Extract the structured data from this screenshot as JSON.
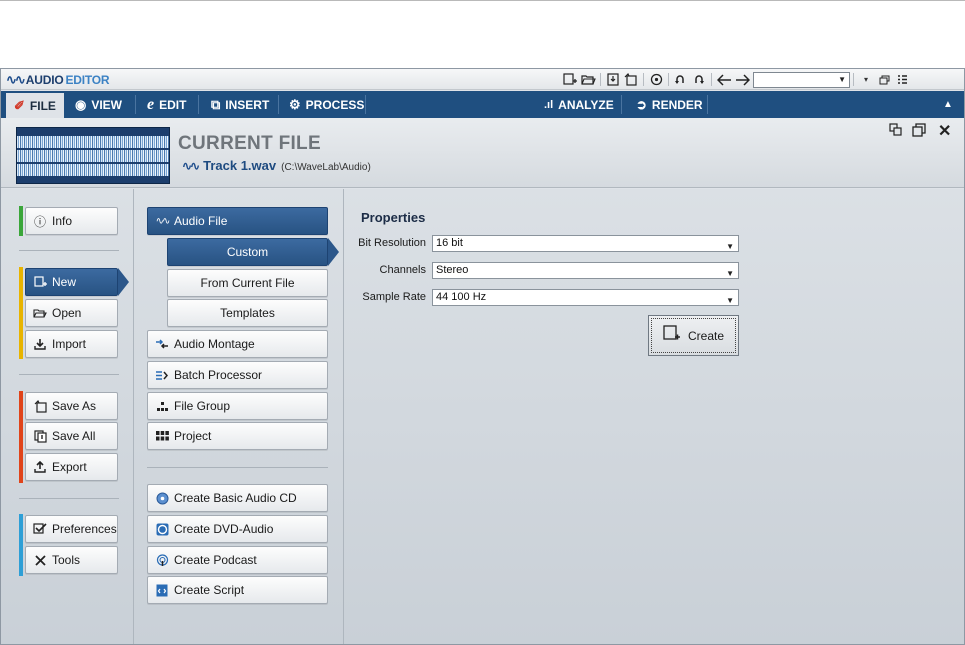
{
  "app": {
    "name_part1": "AUDIO",
    "name_part2": "EDITOR",
    "logo_glyph": "∿∿"
  },
  "tabs": [
    {
      "label": "FILE",
      "icon": "file-icon",
      "active": true
    },
    {
      "label": "VIEW",
      "icon": "eye-icon",
      "active": false
    },
    {
      "label": "EDIT",
      "icon": "edit-icon",
      "active": false
    },
    {
      "label": "INSERT",
      "icon": "insert-icon",
      "active": false
    },
    {
      "label": "PROCESS",
      "icon": "process-icon",
      "active": false
    },
    {
      "label": "ANALYZE",
      "icon": "analyze-icon",
      "active": false
    },
    {
      "label": "RENDER",
      "icon": "render-icon",
      "active": false
    }
  ],
  "header": {
    "title": "CURRENT FILE",
    "file_name": "Track 1.wav",
    "file_path": "(C:\\WaveLab\\Audio)"
  },
  "sidebar": {
    "groups": [
      {
        "color": "#3aa63a",
        "items": [
          {
            "label": "Info",
            "icon": "info-icon"
          }
        ]
      },
      {
        "color": "#e8b400",
        "items": [
          {
            "label": "New",
            "icon": "new-file-icon",
            "selected": true
          },
          {
            "label": "Open",
            "icon": "open-folder-icon"
          },
          {
            "label": "Import",
            "icon": "import-icon"
          }
        ]
      },
      {
        "color": "#e0441a",
        "items": [
          {
            "label": "Save As",
            "icon": "save-as-icon"
          },
          {
            "label": "Save All",
            "icon": "save-all-icon"
          },
          {
            "label": "Export",
            "icon": "export-icon"
          }
        ]
      },
      {
        "color": "#2e9fd6",
        "items": [
          {
            "label": "Preferences",
            "icon": "preferences-icon"
          },
          {
            "label": "Tools",
            "icon": "tools-icon"
          }
        ]
      }
    ]
  },
  "new_types": {
    "audio_file": "Audio File",
    "sub_items": [
      "Custom",
      "From Current File",
      "Templates"
    ],
    "others": [
      {
        "label": "Audio Montage",
        "icon": "audio-montage-icon"
      },
      {
        "label": "Batch Processor",
        "icon": "batch-processor-icon"
      },
      {
        "label": "File Group",
        "icon": "file-group-icon"
      },
      {
        "label": "Project",
        "icon": "project-icon"
      }
    ],
    "create_items": [
      {
        "label": "Create Basic Audio CD",
        "icon": "cd-icon"
      },
      {
        "label": "Create DVD-Audio",
        "icon": "dvd-icon"
      },
      {
        "label": "Create Podcast",
        "icon": "podcast-icon"
      },
      {
        "label": "Create Script",
        "icon": "script-icon"
      }
    ]
  },
  "properties": {
    "title": "Properties",
    "bit_resolution_label": "Bit Resolution",
    "bit_resolution_value": "16 bit",
    "channels_label": "Channels",
    "channels_value": "Stereo",
    "sample_rate_label": "Sample Rate",
    "sample_rate_value": "44 100 Hz",
    "create_label": "Create"
  },
  "colors": {
    "tabbar": "#1f4f80",
    "selected": "#285383"
  }
}
